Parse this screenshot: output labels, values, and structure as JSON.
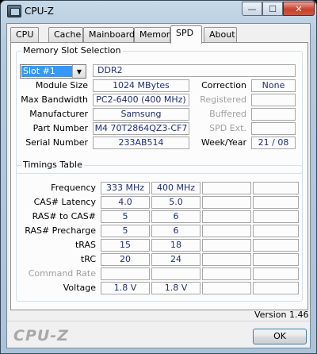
{
  "window": {
    "title": "CPU-Z"
  },
  "titlebar": {
    "minimize": "—",
    "maximize": "☐",
    "close": "✕"
  },
  "tabs": [
    "CPU",
    "Cache",
    "Mainboard",
    "Memory",
    "SPD",
    "About"
  ],
  "active_tab": "SPD",
  "slot": {
    "group_label": "Memory Slot Selection",
    "selected": "Slot #1",
    "type": "DDR2",
    "module_size_label": "Module Size",
    "module_size": "1024 MBytes",
    "max_bandwidth_label": "Max Bandwidth",
    "max_bandwidth": "PC2-6400 (400 MHz)",
    "manufacturer_label": "Manufacturer",
    "manufacturer": "Samsung",
    "part_number_label": "Part Number",
    "part_number": "M4 70T2864QZ3-CF7",
    "serial_number_label": "Serial Number",
    "serial_number": "233AB514",
    "correction_label": "Correction",
    "correction": "None",
    "registered_label": "Registered",
    "registered": "",
    "buffered_label": "Buffered",
    "buffered": "",
    "spd_ext_label": "SPD Ext.",
    "spd_ext": "",
    "week_year_label": "Week/Year",
    "week_year": "21 / 08"
  },
  "timings": {
    "group_label": "Timings Table",
    "labels": {
      "frequency": "Frequency",
      "cas": "CAS# Latency",
      "ras_to_cas": "RAS# to CAS#",
      "ras_precharge": "RAS# Precharge",
      "tras": "tRAS",
      "trc": "tRC",
      "command_rate": "Command Rate",
      "voltage": "Voltage"
    },
    "col1": {
      "frequency": "333 MHz",
      "cas": "4.0",
      "ras_to_cas": "5",
      "ras_precharge": "5",
      "tras": "15",
      "trc": "20",
      "command_rate": "",
      "voltage": "1.8 V"
    },
    "col2": {
      "frequency": "400 MHz",
      "cas": "5.0",
      "ras_to_cas": "6",
      "ras_precharge": "6",
      "tras": "18",
      "trc": "24",
      "command_rate": "",
      "voltage": "1.8 V"
    }
  },
  "footer": {
    "version": "Version 1.46",
    "brand": "CPU-Z",
    "ok": "OK"
  }
}
